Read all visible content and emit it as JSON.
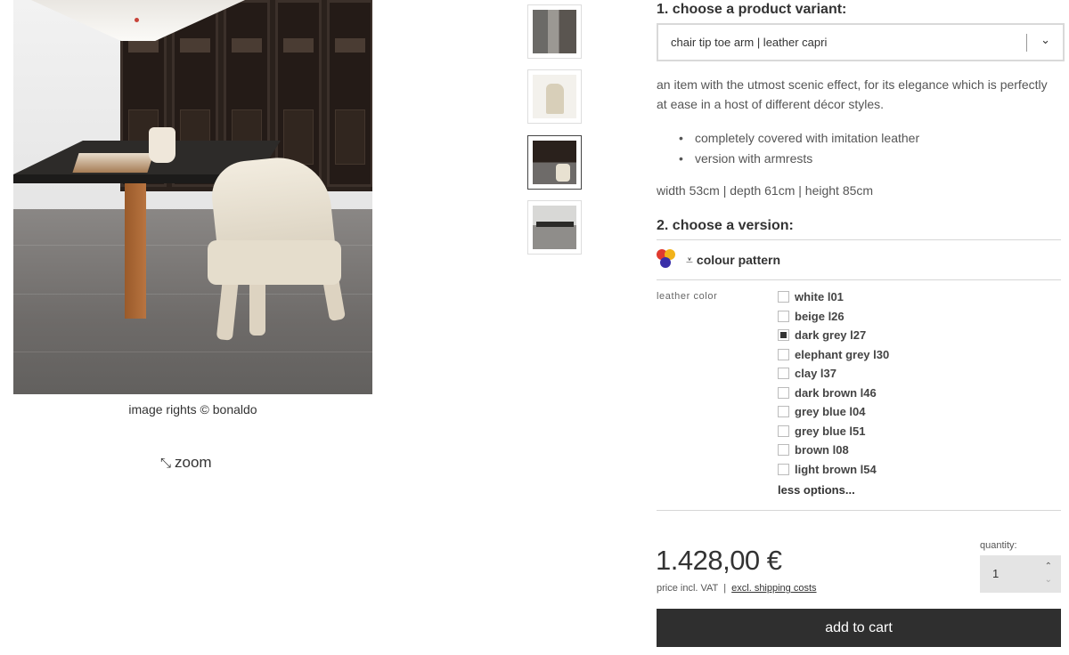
{
  "gallery": {
    "caption": "image rights © bonaldo",
    "zoom_label": "zoom",
    "zoom_icon": "expand-arrows-icon"
  },
  "variant": {
    "heading": "1. choose a product variant:",
    "selected": "chair tip toe arm | leather capri",
    "description": "an item with the utmost scenic effect, for its elegance which is perfectly at ease in a host of different décor styles.",
    "features": [
      "completely covered with imitation leather",
      "version with armrests"
    ],
    "dimensions": "width 53cm | depth 61cm | height 85cm"
  },
  "version": {
    "heading": "2. choose a version:",
    "pattern_label": "colour pattern",
    "pattern_icon": "colour-dots-icon",
    "pattern_colors": [
      "#e03a2f",
      "#f2b31a",
      "#3a2fa8"
    ],
    "option_group_label": "leather color",
    "options": [
      {
        "label": "white l01",
        "checked": false
      },
      {
        "label": "beige l26",
        "checked": false
      },
      {
        "label": "dark grey l27",
        "checked": true
      },
      {
        "label": "elephant grey l30",
        "checked": false
      },
      {
        "label": "clay l37",
        "checked": false
      },
      {
        "label": "dark brown l46",
        "checked": false
      },
      {
        "label": "grey blue l04",
        "checked": false
      },
      {
        "label": "grey blue l51",
        "checked": false
      },
      {
        "label": "brown l08",
        "checked": false
      },
      {
        "label": "light brown l54",
        "checked": false
      }
    ],
    "less_options": "less options..."
  },
  "purchase": {
    "price": "1.428,00 €",
    "vat_note": "price incl. VAT",
    "separator": "|",
    "shipping_link": "excl. shipping costs",
    "quantity_label": "quantity:",
    "quantity": "1",
    "add_to_cart": "add to cart"
  }
}
